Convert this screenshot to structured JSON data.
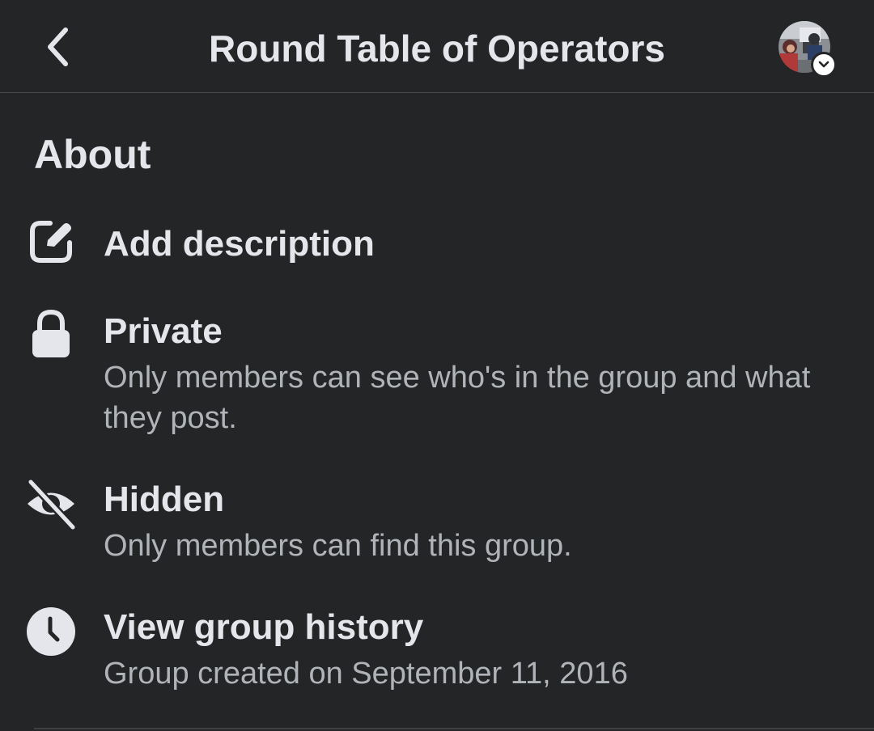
{
  "header": {
    "title": "Round Table of Operators",
    "back_icon": "chevron-left-icon",
    "avatar_badge_icon": "chevron-down-icon"
  },
  "about": {
    "title": "About",
    "items": [
      {
        "icon": "edit-icon",
        "label": "Add description",
        "subtitle": ""
      },
      {
        "icon": "lock-icon",
        "label": "Private",
        "subtitle": "Only members can see who's in the group and what they post."
      },
      {
        "icon": "eye-slash-icon",
        "label": "Hidden",
        "subtitle": "Only members can find this group."
      },
      {
        "icon": "clock-icon",
        "label": "View group history",
        "subtitle": "Group created on September 11, 2016"
      }
    ]
  },
  "colors": {
    "background": "#242526",
    "primary_text": "#e4e6eb",
    "secondary_text": "#b0b3b8",
    "divider": "#4a4b4c"
  }
}
